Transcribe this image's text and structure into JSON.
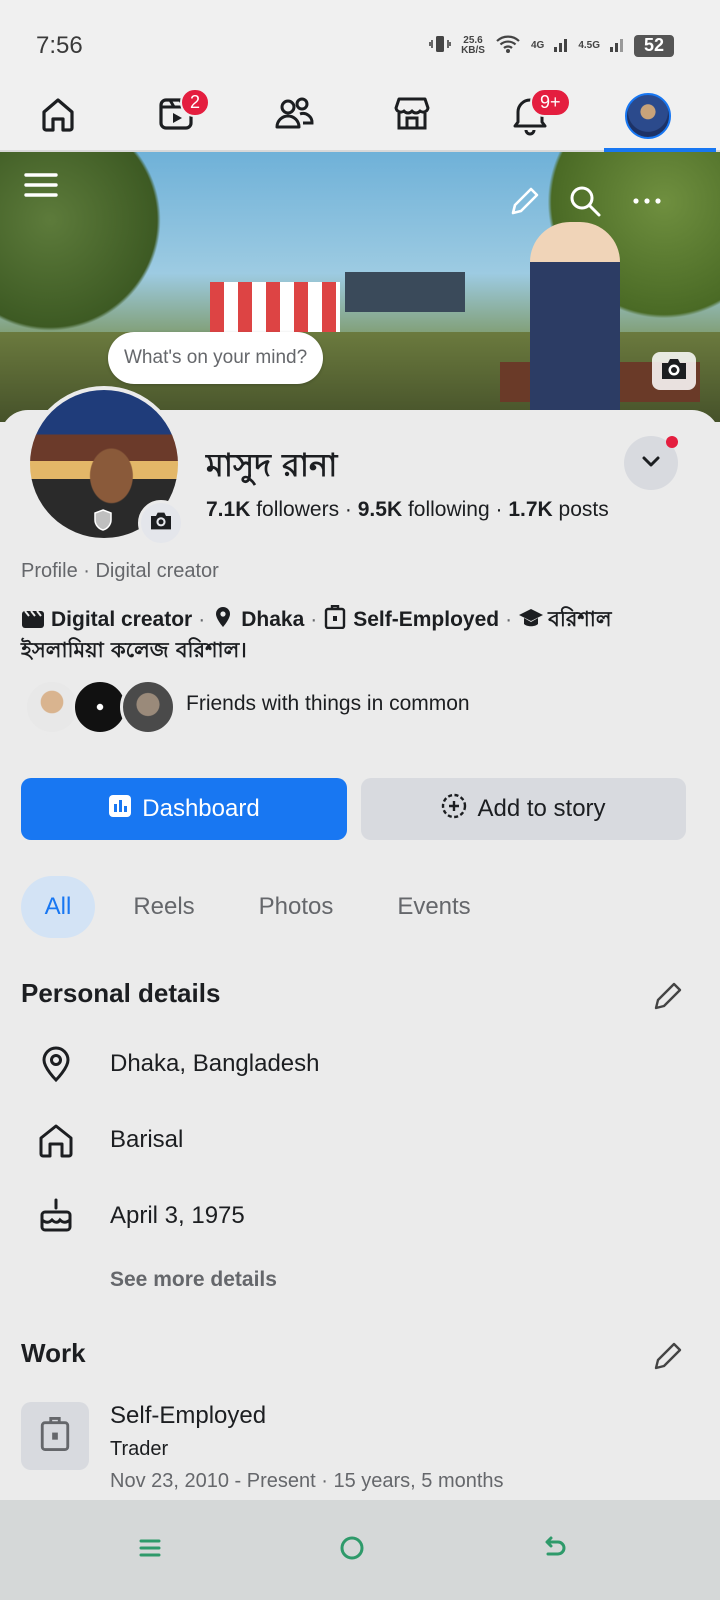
{
  "status": {
    "time": "7:56",
    "net_speed": "25.6",
    "net_unit": "KB/S",
    "sig1": "4G",
    "sig2": "4.5G",
    "battery": "52"
  },
  "nav": {
    "watch_badge": "2",
    "notif_badge": "9+"
  },
  "cover": {
    "mind_prompt": "What's on your mind?"
  },
  "profile": {
    "name": "মাসুদ রানা",
    "followers_count": "7.1K",
    "followers_label": "followers",
    "following_count": "9.5K",
    "following_label": "following",
    "posts_count": "1.7K",
    "posts_label": "posts",
    "subtitle": "Profile · Digital creator"
  },
  "intro": {
    "category": "Digital creator",
    "city": "Dhaka",
    "job": "Self-Employed",
    "school": "বরিশাল ইসলামিয়া কলেজ বরিশাল।"
  },
  "friends": {
    "text": "Friends with things in common"
  },
  "actions": {
    "dashboard": "Dashboard",
    "add_story": "Add to story"
  },
  "tabs": [
    "All",
    "Reels",
    "Photos",
    "Events"
  ],
  "personal": {
    "title": "Personal details",
    "location": "Dhaka, Bangladesh",
    "hometown": "Barisal",
    "birthday": "April 3, 1975",
    "see_more": "See more details"
  },
  "work": {
    "title": "Work",
    "employer": "Self-Employed",
    "role": "Trader",
    "dates": "Nov 23, 2010 - Present · 15 years, 5 months"
  },
  "colors": {
    "accent": "#1877f2",
    "badge": "#e41e3f",
    "background": "#ebebeb"
  }
}
